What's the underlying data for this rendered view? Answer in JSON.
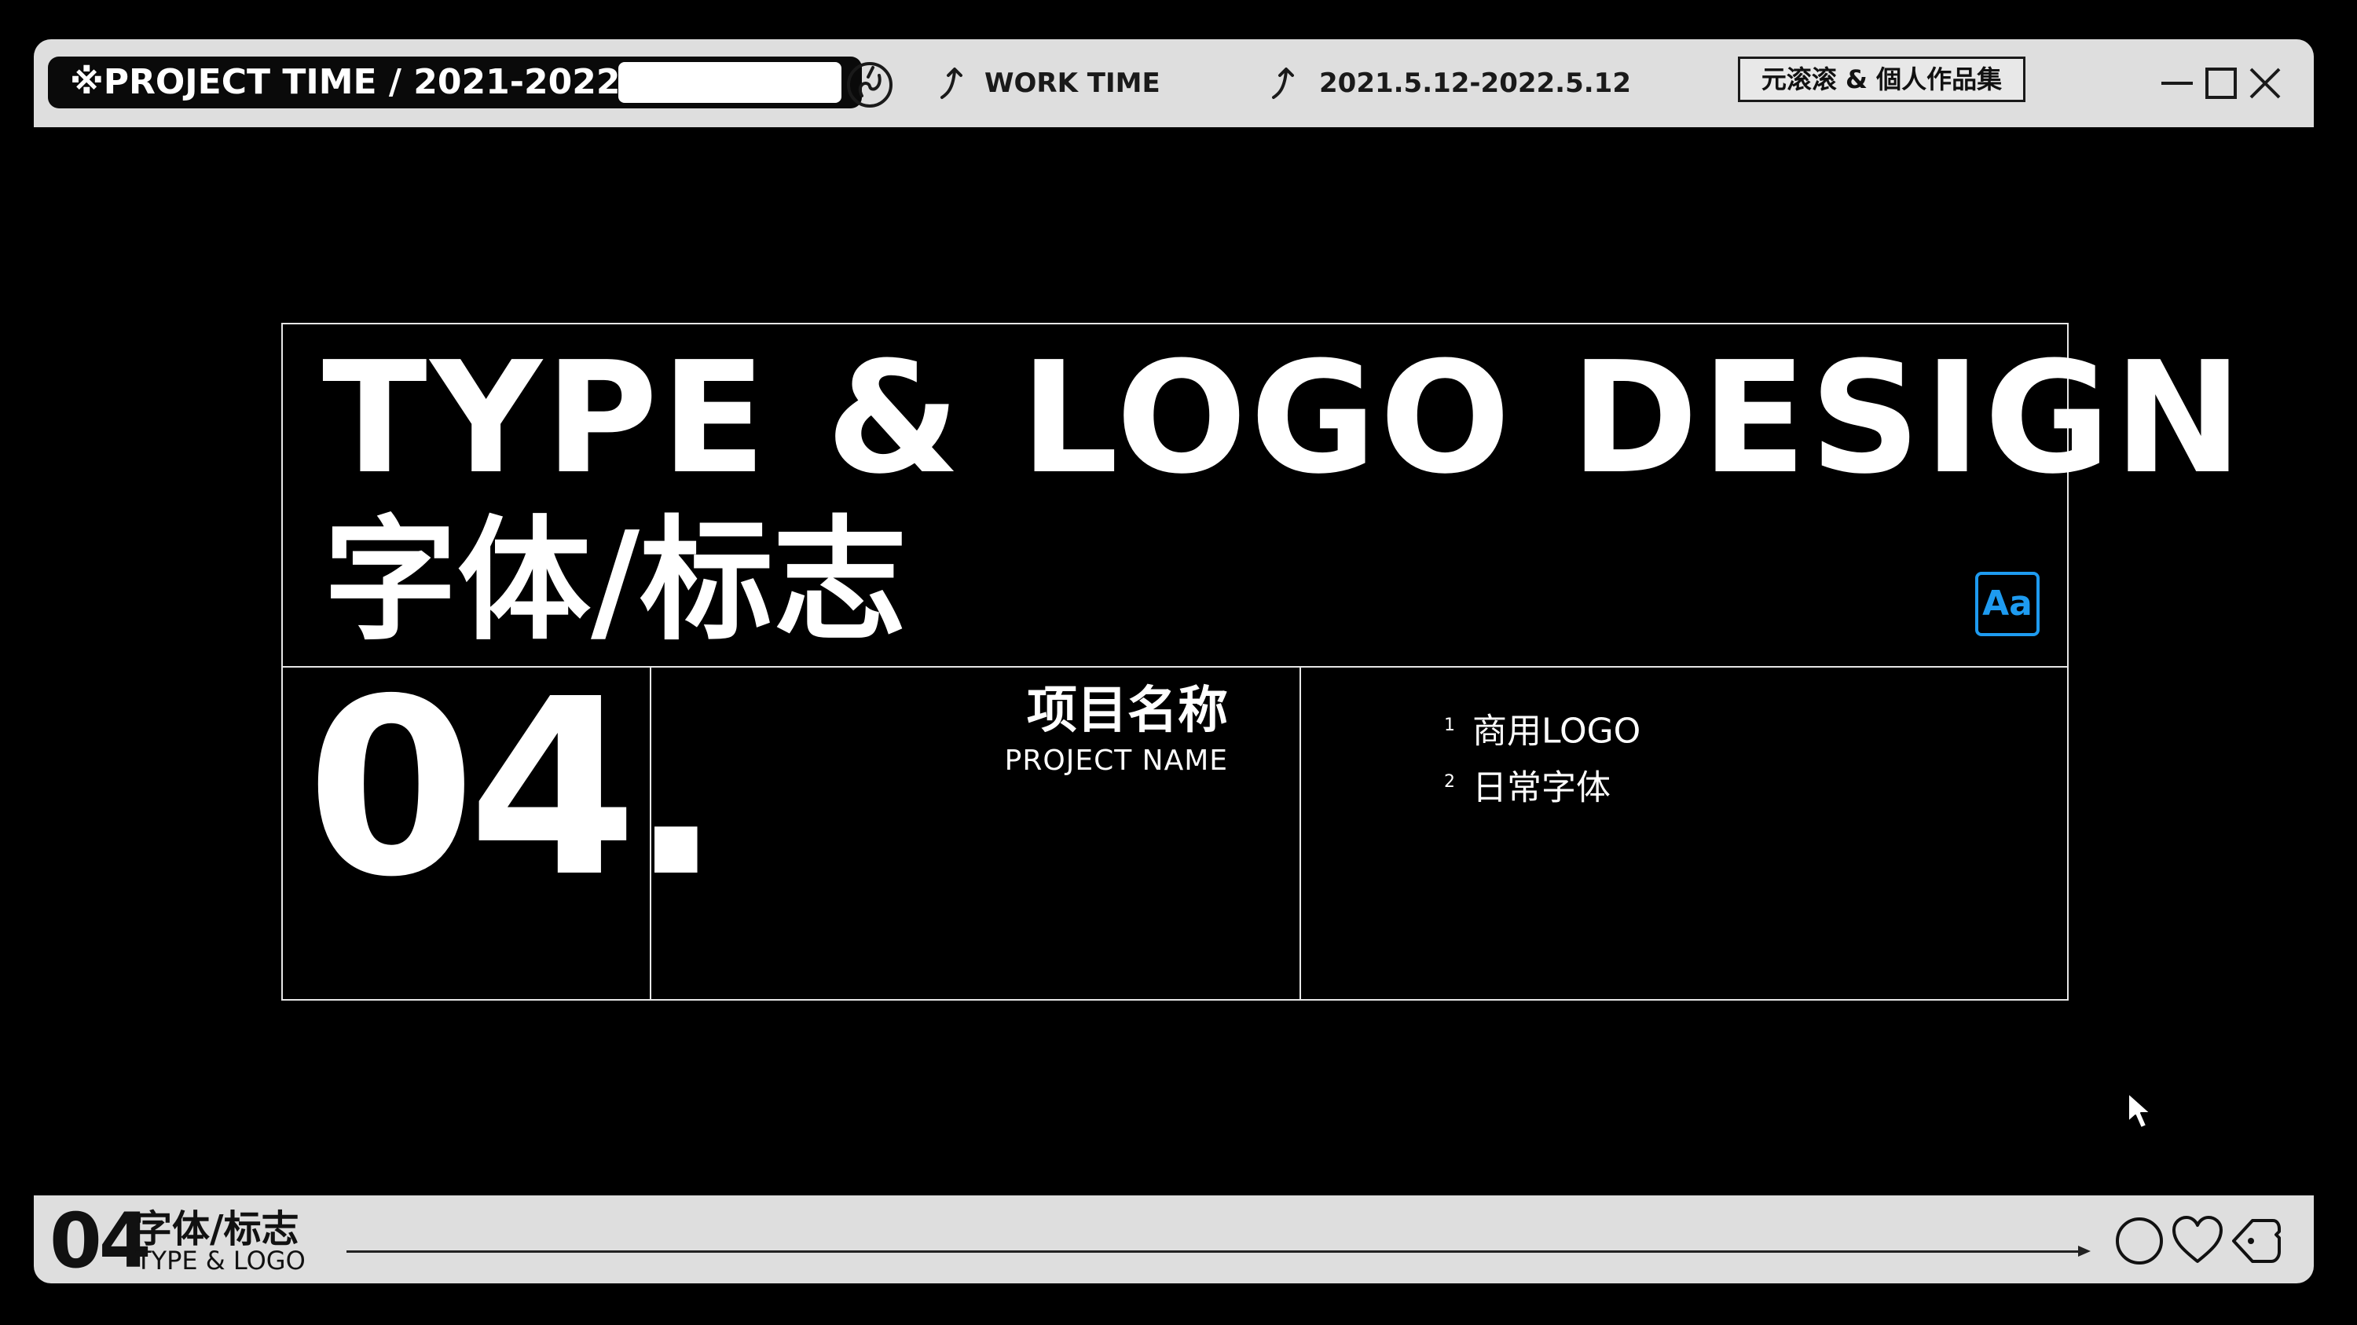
{
  "topbar": {
    "project_label": "※PROJECT TIME / 2021-2022",
    "project_field_value": "",
    "work_time_label": "WORK TIME",
    "date_range": "2021.5.12-2022.5.12",
    "portfolio_badge": "元滚滚 & 個人作品集",
    "window_controls": [
      "minimize-icon",
      "maximize-icon",
      "close-icon"
    ]
  },
  "main": {
    "title_en": "TYPE & LOGO DESIGN",
    "title_zh": "字体/标志",
    "section_number": "04.",
    "project_name_zh": "项目名称",
    "project_name_en": "PROJECT NAME",
    "items": [
      {
        "num": "1",
        "label": "商用LOGO"
      },
      {
        "num": "2",
        "label": "日常字体"
      }
    ],
    "app_icon": {
      "name": "font-aa-icon",
      "text": "Aa",
      "color": "#1e9bf0"
    }
  },
  "bottombar": {
    "number": "04",
    "title_zh": "字体/标志",
    "title_en": "TYPE & LOGO",
    "icons": [
      "circle-icon",
      "heart-icon",
      "tag-icon"
    ]
  },
  "colors": {
    "background": "#000000",
    "bar": "#dedede",
    "accent": "#1e9bf0",
    "text_light": "#ffffff",
    "text_dark": "#111111"
  }
}
